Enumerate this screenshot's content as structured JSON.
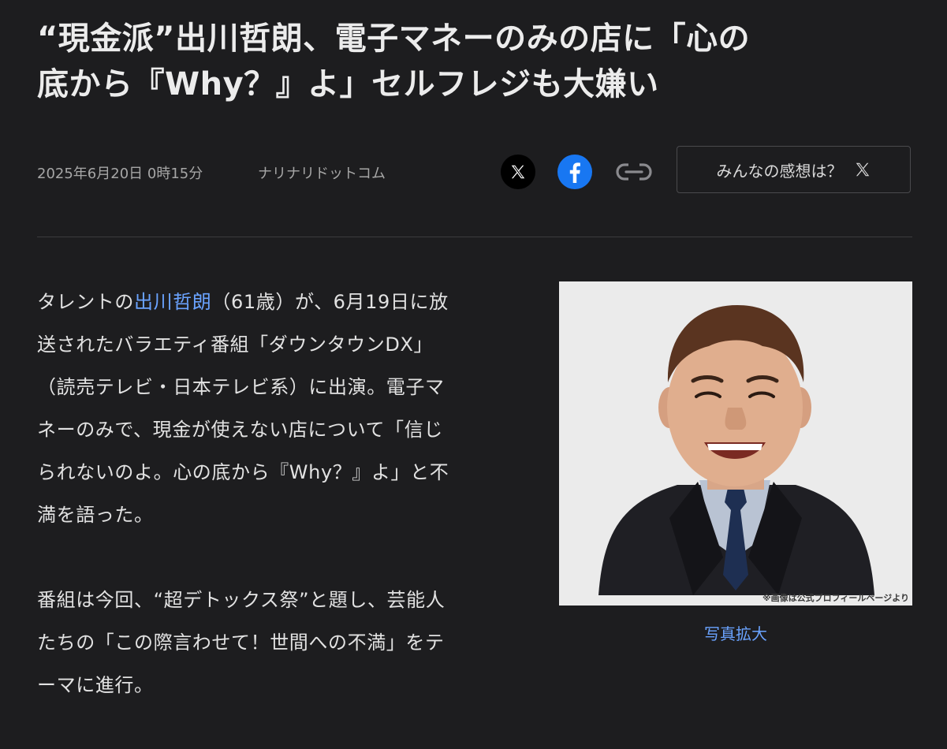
{
  "article": {
    "headline_lines": [
      "“現金派”出川哲朗、電子マネーのみの店に「心の",
      "底から『Why？』よ」セルフレジも大嫌い"
    ],
    "date": "2025年6月20日 0時15分",
    "source": "ナリナリドットコム"
  },
  "share": {
    "x_icon": "x-logo-icon",
    "facebook_icon": "facebook-logo-icon",
    "link_icon": "link-icon",
    "reactions_label": "みんなの感想は？"
  },
  "body": {
    "p1": {
      "prefix": "タレントの",
      "person_link": "出川哲朗",
      "line1_rest": "（61歳）が、6月19日に放",
      "line2": "送されたバラエティ番組「ダウンタウンDX」",
      "line3": "（読売テレビ・日本テレビ系）に出演。電子マ",
      "line4": "ネーのみで、現金が使えない店について「信じ",
      "line5": "られないのよ。心の底から『Why？』よ」と不",
      "line6": "満を語った。"
    },
    "p2": {
      "line1": "番組は今回、“超デトックス祭”と題し、芸能人",
      "line2": "たちの「この際言わせて！世間への不満」をテ",
      "line3": "ーマに進行。"
    }
  },
  "photo": {
    "caption": "※画像は公式プロフィールページより",
    "enlarge_label": "写真拡大"
  },
  "colors": {
    "background": "#1d1d1f",
    "link": "#6aa3ff",
    "facebook": "#1877f2"
  }
}
